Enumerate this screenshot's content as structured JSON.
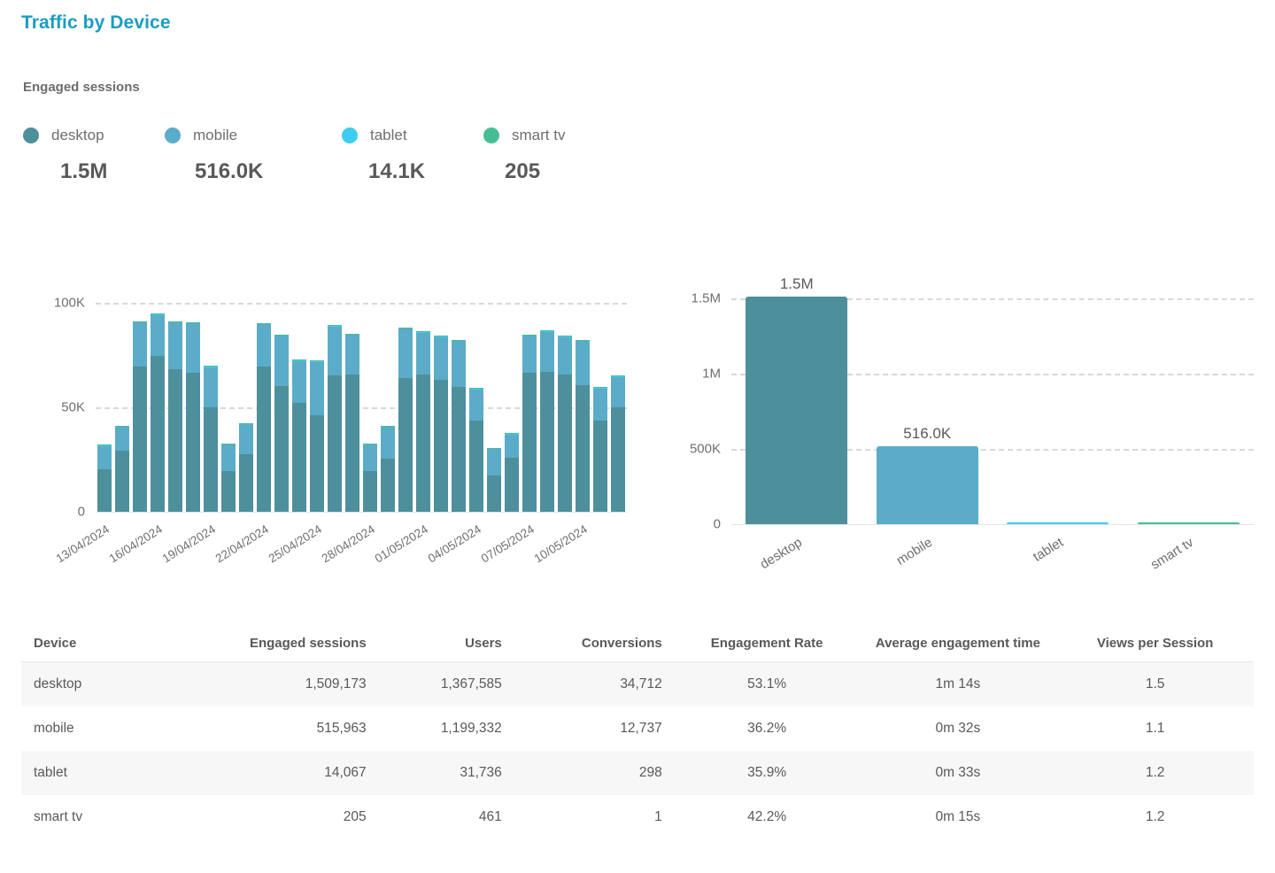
{
  "header": {
    "title": "Traffic by Device",
    "metric_label": "Engaged sessions"
  },
  "colors": {
    "title": "#1b9dc4",
    "desktop": "#4e8f9c",
    "mobile": "#5bacc8",
    "tablet": "#3ecdf0",
    "smart_tv": "#45be96",
    "grid": "#d8d8d8",
    "text": "#6d6e70",
    "row_alt": "#f7f7f7"
  },
  "legend": [
    {
      "name": "desktop",
      "value": "1.5M",
      "color_key": "desktop"
    },
    {
      "name": "mobile",
      "value": "516.0K",
      "color_key": "mobile"
    },
    {
      "name": "tablet",
      "value": "14.1K",
      "color_key": "tablet"
    },
    {
      "name": "smart tv",
      "value": "205",
      "color_key": "smart_tv"
    }
  ],
  "chart_data": [
    {
      "id": "timeseries",
      "type": "bar",
      "stacked": true,
      "title": "",
      "xlabel": "",
      "ylabel": "",
      "ylim": [
        0,
        110000
      ],
      "grid": true,
      "ytick_labels": [
        "0",
        "50K",
        "100K"
      ],
      "ytick_values": [
        0,
        50000,
        100000
      ],
      "legend_position": "top",
      "x": [
        "13/04/2024",
        "14/04/2024",
        "15/04/2024",
        "16/04/2024",
        "17/04/2024",
        "18/04/2024",
        "19/04/2024",
        "20/04/2024",
        "21/04/2024",
        "22/04/2024",
        "23/04/2024",
        "24/04/2024",
        "25/04/2024",
        "26/04/2024",
        "27/04/2024",
        "28/04/2024",
        "29/04/2024",
        "30/04/2024",
        "01/05/2024",
        "02/05/2024",
        "03/05/2024",
        "04/05/2024",
        "05/05/2024",
        "06/05/2024",
        "07/05/2024",
        "08/05/2024",
        "09/05/2024",
        "10/05/2024",
        "11/05/2024",
        "12/05/2024"
      ],
      "xtick_labels": [
        "13/04/2024",
        "16/04/2024",
        "19/04/2024",
        "22/04/2024",
        "25/04/2024",
        "28/04/2024",
        "01/05/2024",
        "04/05/2024",
        "07/05/2024",
        "10/05/2024"
      ],
      "xtick_indices": [
        0,
        3,
        6,
        9,
        12,
        15,
        18,
        21,
        24,
        27
      ],
      "series": [
        {
          "name": "desktop",
          "color_key": "desktop",
          "values": [
            20500,
            29000,
            69500,
            74500,
            68000,
            66500,
            50000,
            19500,
            27500,
            69500,
            60000,
            52000,
            46000,
            65000,
            65500,
            19500,
            25500,
            64000,
            65500,
            63000,
            59500,
            43500,
            17500,
            26000,
            66500,
            67000,
            65500,
            60500,
            43500,
            50000
          ]
        },
        {
          "name": "mobile",
          "color_key": "mobile",
          "values": [
            11000,
            11500,
            21000,
            19500,
            22500,
            23500,
            19000,
            12500,
            14500,
            20000,
            24000,
            20000,
            25500,
            23500,
            19000,
            12500,
            15000,
            23500,
            20000,
            20500,
            22000,
            15000,
            12500,
            11000,
            17500,
            19000,
            18000,
            21000,
            15500,
            14500
          ]
        },
        {
          "name": "tablet",
          "color_key": "tablet",
          "values": [
            500,
            500,
            600,
            700,
            600,
            550,
            600,
            400,
            450,
            600,
            550,
            500,
            600,
            600,
            550,
            450,
            450,
            550,
            550,
            600,
            550,
            500,
            400,
            450,
            550,
            600,
            550,
            550,
            450,
            500
          ]
        },
        {
          "name": "smart tv",
          "color_key": "smart_tv",
          "values": [
            60,
            60,
            70,
            80,
            70,
            65,
            70,
            50,
            55,
            70,
            65,
            60,
            70,
            70,
            65,
            55,
            55,
            65,
            65,
            70,
            65,
            60,
            50,
            55,
            65,
            70,
            65,
            65,
            55,
            60
          ]
        }
      ]
    },
    {
      "id": "totals",
      "type": "bar",
      "stacked": false,
      "title": "",
      "xlabel": "",
      "ylabel": "",
      "ylim": [
        0,
        1600000
      ],
      "grid": true,
      "ytick_labels": [
        "0",
        "500K",
        "1M",
        "1.5M"
      ],
      "ytick_values": [
        0,
        500000,
        1000000,
        1500000
      ],
      "categories": [
        "desktop",
        "mobile",
        "tablet",
        "smart tv"
      ],
      "values": [
        1509173,
        515963,
        14067,
        205
      ],
      "value_labels": [
        "1.5M",
        "516.0K",
        "",
        ""
      ],
      "color_keys": [
        "desktop",
        "mobile",
        "tablet",
        "smart_tv"
      ]
    }
  ],
  "table": {
    "columns": [
      {
        "label": "Device",
        "align": "c-left"
      },
      {
        "label": "Engaged sessions",
        "align": "c-right"
      },
      {
        "label": "Users",
        "align": "c-right"
      },
      {
        "label": "Conversions",
        "align": "c-right"
      },
      {
        "label": "Engagement Rate",
        "align": "c-center"
      },
      {
        "label": "Average engagement time",
        "align": "c-center"
      },
      {
        "label": "Views per Session",
        "align": "c-center"
      }
    ],
    "rows": [
      {
        "device": "desktop",
        "engaged_sessions": "1,509,173",
        "users": "1,367,585",
        "conversions": "34,712",
        "engagement_rate": "53.1%",
        "avg_engagement_time": "1m 14s",
        "views_per_session": "1.5"
      },
      {
        "device": "mobile",
        "engaged_sessions": "515,963",
        "users": "1,199,332",
        "conversions": "12,737",
        "engagement_rate": "36.2%",
        "avg_engagement_time": "0m 32s",
        "views_per_session": "1.1"
      },
      {
        "device": "tablet",
        "engaged_sessions": "14,067",
        "users": "31,736",
        "conversions": "298",
        "engagement_rate": "35.9%",
        "avg_engagement_time": "0m 33s",
        "views_per_session": "1.2"
      },
      {
        "device": "smart tv",
        "engaged_sessions": "205",
        "users": "461",
        "conversions": "1",
        "engagement_rate": "42.2%",
        "avg_engagement_time": "0m 15s",
        "views_per_session": "1.2"
      }
    ]
  }
}
